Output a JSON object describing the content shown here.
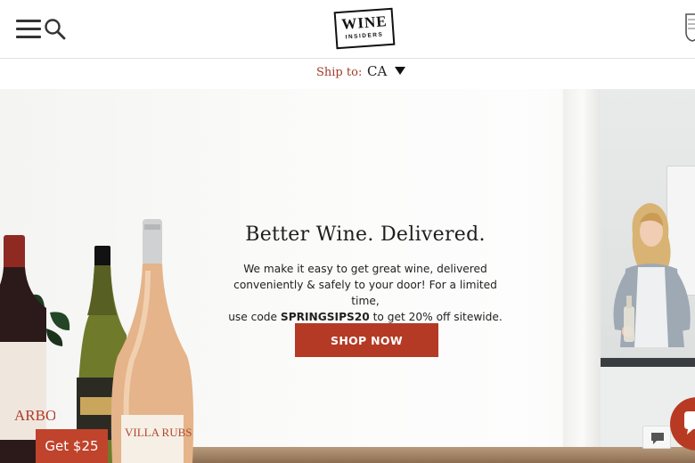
{
  "header": {
    "logo_word": "WINE",
    "logo_sub": "INSIDERS"
  },
  "ship_bar": {
    "label": "Ship to:",
    "country": "CA"
  },
  "hero": {
    "title": "Better Wine. Delivered.",
    "body_line1": "We make it easy to get great wine, delivered",
    "body_line2": "conveniently & safely to your door! For a limited time,",
    "body_line3_prefix": "use code ",
    "promo_code": "SPRINGSIPS20",
    "body_line3_suffix": " to get 20% off sitewide.",
    "cta_label": "SHOP NOW",
    "bottle_label_left": "ARBOS",
    "bottle_label_rose": "VILLA RUBS"
  },
  "promo_tab": {
    "label": "Get $25"
  },
  "colors": {
    "accent": "#b53a25",
    "ship_label": "#a03c2a",
    "header_text": "#1f1f1f"
  },
  "icons": {
    "menu": "hamburger-menu-icon",
    "search": "magnifier-icon",
    "account": "shield-crest-icon",
    "chat": "speech-bubble-icon"
  }
}
